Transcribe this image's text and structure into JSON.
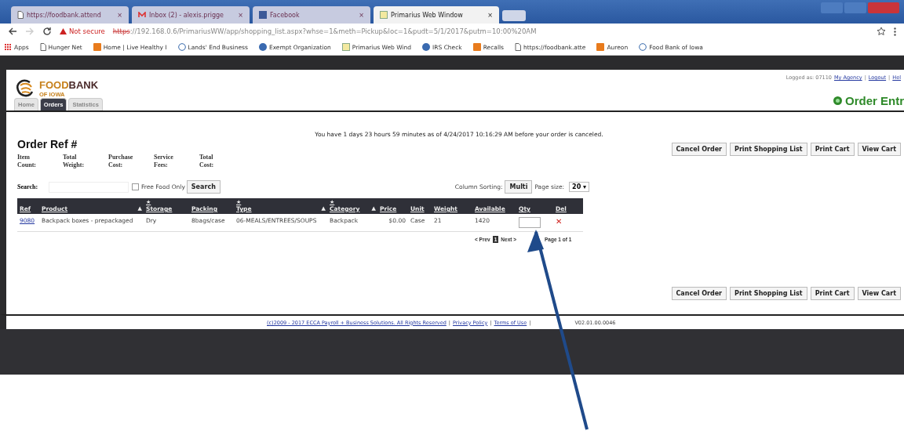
{
  "browser": {
    "tabs": [
      {
        "title": "https://foodbank.attend",
        "kind": "page",
        "close": "×",
        "selected": false
      },
      {
        "title": "Inbox (2) - alexis.prigge",
        "kind": "mail",
        "close": "×",
        "selected": false
      },
      {
        "title": "Facebook",
        "kind": "social",
        "close": "×",
        "selected": false
      },
      {
        "title": "Primarius Web Window",
        "kind": "app",
        "close": "×",
        "selected": true
      }
    ],
    "address": {
      "security": "Not secure",
      "scheme": "https",
      "rest": "://192.168.0.6/PrimariusWW/app/shopping_list.aspx?whse=1&meth=Pickup&loc=1&pudt=5/1/2017&putm=10:00%20AM"
    },
    "bookmarks": [
      {
        "label": "Apps",
        "kind": "grid"
      },
      {
        "label": "Hunger Net",
        "kind": "page"
      },
      {
        "label": "Home | Live Healthy I",
        "kind": "orange"
      },
      {
        "label": "Lands' End Business",
        "kind": "globe"
      },
      {
        "label": "Exempt Organization",
        "kind": "blue"
      },
      {
        "label": "Primarius Web Wind",
        "kind": "app"
      },
      {
        "label": "IRS Check",
        "kind": "blue"
      },
      {
        "label": "Recalls",
        "kind": "orange"
      },
      {
        "label": "https://foodbank.atte",
        "kind": "page"
      },
      {
        "label": "Aureon",
        "kind": "orange"
      },
      {
        "label": "Food Bank of Iowa",
        "kind": "globe"
      }
    ]
  },
  "site": {
    "brand_a": "FOOD",
    "brand_b": "BANK",
    "brand_sub": "OF IOWA",
    "nav": [
      {
        "label": "Home",
        "selected": false
      },
      {
        "label": "Orders",
        "selected": true
      },
      {
        "label": "Statistics",
        "selected": false
      }
    ],
    "logged_as": "Logged as: 07110",
    "user_links": [
      {
        "label": "My Agency"
      },
      {
        "sep": "|",
        "label": "Logout"
      },
      {
        "sep": "|",
        "label": "Hel"
      }
    ],
    "page_title": "Order Entr"
  },
  "notice": "You have 1 days 23 hours 59 minutes as of 4/24/2017 10:16:29 AM before your order is canceled.",
  "order_ref": "Order Ref #",
  "summary": [
    [
      "Item",
      "Count:"
    ],
    [
      "Total",
      "Weight:"
    ],
    [
      "Purchase",
      "Cost:"
    ],
    [
      "Service",
      "Fees:"
    ],
    [
      "Total",
      "Cost:"
    ]
  ],
  "actions": [
    "Cancel Order",
    "Print Shopping List",
    "Print Cart",
    "View Cart"
  ],
  "search": {
    "label": "Search:",
    "free_food": {
      "label": "Free Food Only",
      "checked": false
    },
    "button": "Search"
  },
  "sorting": {
    "label": "Column Sorting:",
    "button": "Multi",
    "page_size_label": "Page size:",
    "page_size": "20 ▾"
  },
  "table": {
    "columns": [
      {
        "label": "Ref"
      },
      {
        "label": "Product",
        "sort": "▲"
      },
      {
        "label": "Storage",
        "star": "★"
      },
      {
        "label": "Packing"
      },
      {
        "label": "Type",
        "star": "★",
        "sort": "▲"
      },
      {
        "label": "Category",
        "star": "★",
        "sort": "▲"
      },
      {
        "label": "Price"
      },
      {
        "label": "Unit"
      },
      {
        "label": "Weight"
      },
      {
        "label": "Available"
      },
      {
        "label": "Qty"
      },
      {
        "label": "Del"
      }
    ],
    "rows": [
      {
        "ref": "9080",
        "product": "Backpack boxes - prepackaged",
        "storage": "Dry",
        "packing": "8bags/case",
        "type": "06-MEALS/ENTREES/SOUPS",
        "category": "Backpack",
        "price": "$0.00",
        "unit": "Case",
        "weight": "21",
        "available": "1420",
        "delete": "✕"
      }
    ]
  },
  "pager": {
    "prev": "< Prev",
    "pages": [
      {
        "label": "1",
        "selected": true
      }
    ],
    "next": "Next >",
    "info": "Page 1 of 1"
  },
  "bottom_actions": [
    "Cancel Order",
    "Print Shopping List",
    "Print Cart",
    "View Cart"
  ],
  "footer": {
    "copyright": "(c)2009 - 2017 ECCA Payroll + Business Solutions. All Rights Reserved",
    "items": [
      {
        "sep": "|",
        "label": "Privacy Policy"
      },
      {
        "sep": "|",
        "label": "Terms of Use"
      }
    ],
    "version_sep": "|",
    "version": "V02.01.00.0046"
  }
}
